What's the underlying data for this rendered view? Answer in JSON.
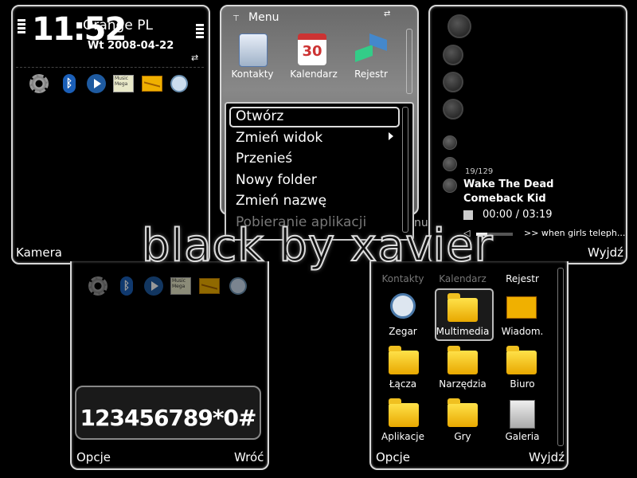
{
  "idle": {
    "time": "11:52",
    "operator": "Orange PL",
    "date": "Wt 2008-04-22",
    "left_softkey": "Kamera",
    "shortcut_icons": [
      "gear-icon",
      "bluetooth-icon",
      "player-icon",
      "multimedia-icon",
      "message-icon",
      "clock-icon"
    ],
    "multimedia_icon_text": "Music Mega"
  },
  "menu": {
    "title": "Menu",
    "icons": [
      {
        "label": "Kontakty",
        "name": "contacts-icon"
      },
      {
        "label": "Kalendarz",
        "name": "calendar-icon",
        "glyph": "30"
      },
      {
        "label": "Rejestr",
        "name": "log-icon"
      }
    ],
    "context_items": [
      {
        "label": "Otwórz",
        "selected": true
      },
      {
        "label": "Zmień widok",
        "submenu": true
      },
      {
        "label": "Przenieś"
      },
      {
        "label": "Nowy folder"
      },
      {
        "label": "Zmień nazwę"
      },
      {
        "label": "Pobieranie aplikacji",
        "disabled": true
      }
    ],
    "behind_text": "nu"
  },
  "music": {
    "track_counter": "19/129",
    "title": "Wake The Dead",
    "artist": "Comeback Kid",
    "time": "00:00 / 03:19",
    "ticker": ">> when girls teleph...",
    "right_softkey": "Wyjdź"
  },
  "watermark": "black by xavier",
  "dialer": {
    "number": "123456789*0#",
    "left_softkey": "Opcje",
    "right_softkey": "Wróć"
  },
  "grid": {
    "top_row_labels": [
      "Kontakty",
      "Kalendarz",
      "Rejestr"
    ],
    "items": [
      {
        "label": "Zegar",
        "name": "clock-app-icon"
      },
      {
        "label": "Multimedia",
        "name": "multimedia-folder-icon",
        "selected": true
      },
      {
        "label": "Wiadom.",
        "name": "messages-app-icon"
      },
      {
        "label": "Łącza",
        "name": "connectivity-folder-icon"
      },
      {
        "label": "Narzędzia",
        "name": "tools-folder-icon"
      },
      {
        "label": "Biuro",
        "name": "office-folder-icon"
      },
      {
        "label": "Aplikacje",
        "name": "apps-folder-icon"
      },
      {
        "label": "Gry",
        "name": "games-folder-icon"
      },
      {
        "label": "Galeria",
        "name": "gallery-app-icon"
      }
    ],
    "left_softkey": "Opcje",
    "right_softkey": "Wyjdź"
  },
  "colors": {
    "accent": "#1e5aa0",
    "frame": "#d8d8d8",
    "folder": "#f5c400"
  }
}
